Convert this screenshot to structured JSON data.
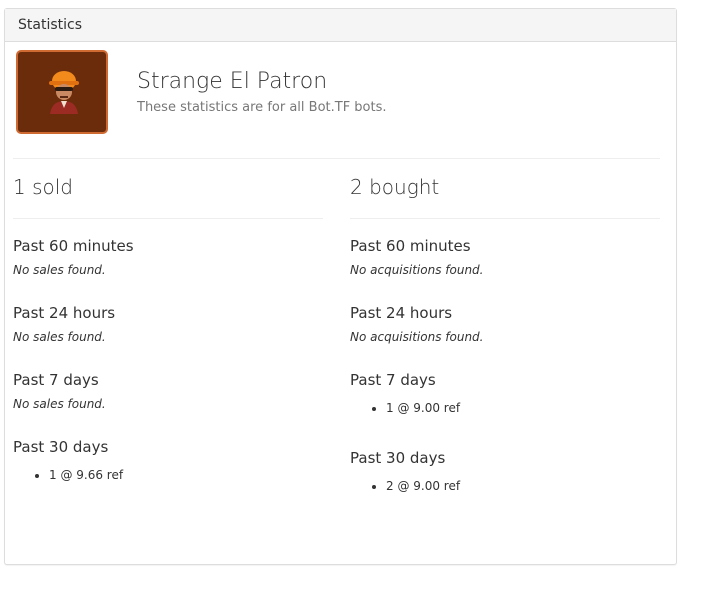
{
  "panel": {
    "title": "Statistics"
  },
  "item": {
    "name": "Strange El Patron",
    "subtitle": "These statistics are for all Bot.TF bots.",
    "icon": "hardhat-avatar-icon",
    "border_color": "#cf6a32",
    "background_color": "#6a2c0b"
  },
  "sold": {
    "title": "1 sold",
    "periods": [
      {
        "label": "Past 60 minutes",
        "empty": "No sales found."
      },
      {
        "label": "Past 24 hours",
        "empty": "No sales found."
      },
      {
        "label": "Past 7 days",
        "empty": "No sales found."
      },
      {
        "label": "Past 30 days",
        "entries": [
          "1 @ 9.66 ref"
        ]
      }
    ]
  },
  "bought": {
    "title": "2 bought",
    "periods": [
      {
        "label": "Past 60 minutes",
        "empty": "No acquisitions found."
      },
      {
        "label": "Past 24 hours",
        "empty": "No acquisitions found."
      },
      {
        "label": "Past 7 days",
        "entries": [
          "1 @ 9.00 ref"
        ]
      },
      {
        "label": "Past 30 days",
        "entries": [
          "2 @ 9.00 ref"
        ]
      }
    ]
  }
}
